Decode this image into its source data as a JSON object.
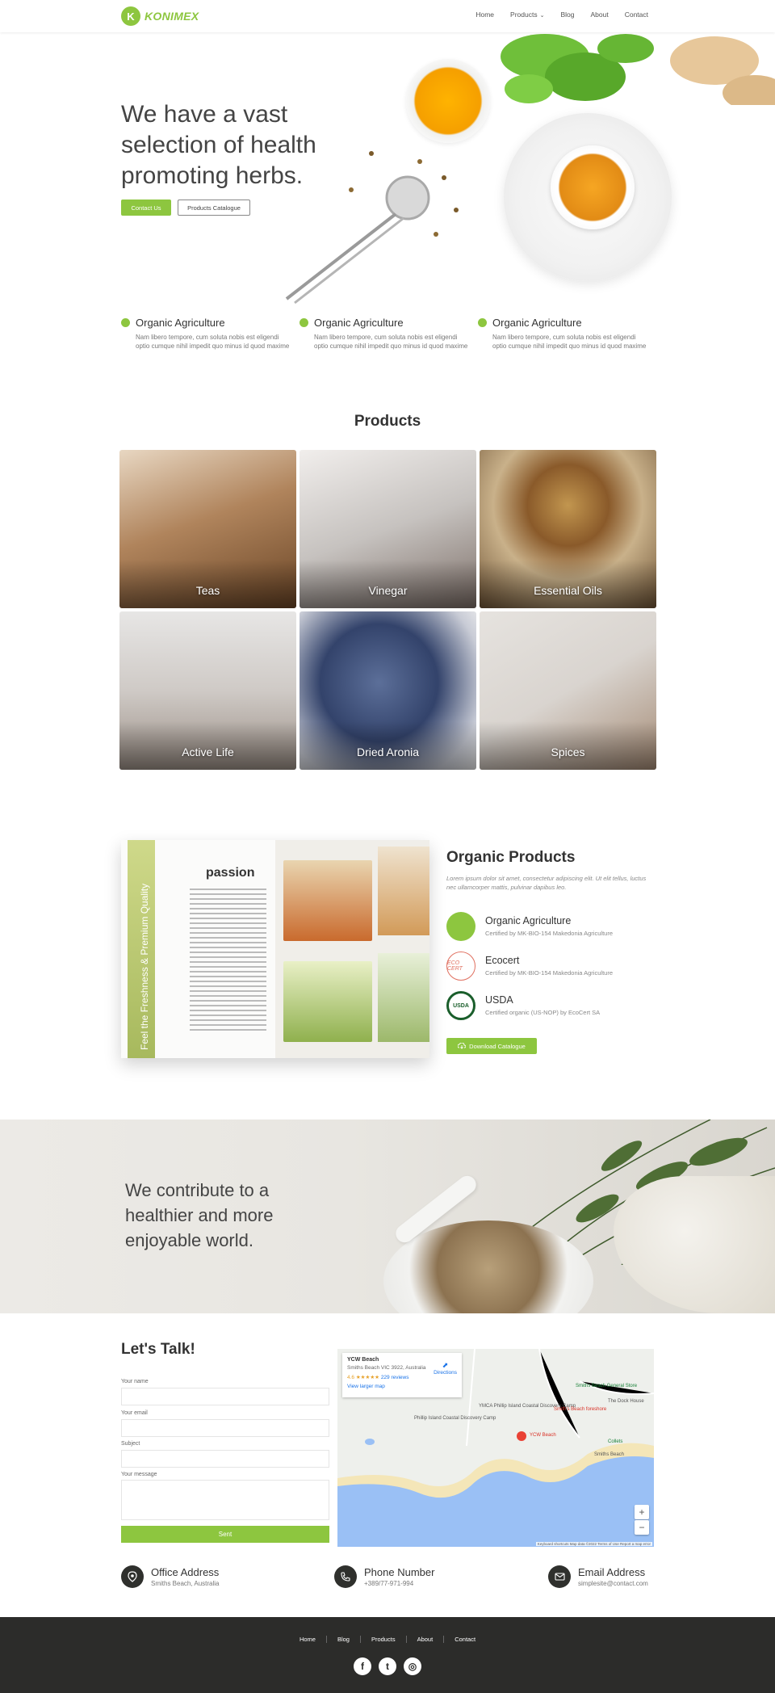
{
  "brand": {
    "logo_letter": "K",
    "name": "KONIMEX",
    "accent": "#8dc63f"
  },
  "nav": {
    "items": [
      "Home",
      "Products",
      "Blog",
      "About",
      "Contact"
    ],
    "products_caret": "⌄"
  },
  "hero": {
    "title": "We have a vast selection of health promoting herbs.",
    "primary_button": "Contact Us",
    "secondary_button": "Products Catalogue"
  },
  "features": [
    {
      "title": "Organic Agriculture",
      "desc": "Nam libero tempore, cum soluta nobis est eligendi optio cumque nihil impedit quo minus id quod maxime"
    },
    {
      "title": "Organic Agriculture",
      "desc": "Nam libero tempore, cum soluta nobis est eligendi optio cumque nihil impedit quo minus id quod maxime"
    },
    {
      "title": "Organic Agriculture",
      "desc": "Nam libero tempore, cum soluta nobis est eligendi optio cumque nihil impedit quo minus id quod maxime"
    }
  ],
  "products": {
    "title": "Products",
    "items": [
      "Teas",
      "Vinegar",
      "Essential Oils",
      "Active Life",
      "Dried Aronia",
      "Spices"
    ]
  },
  "catalog_image": {
    "strip_text": "Feel the Freshness & Premium Quality",
    "brand": "passion"
  },
  "organic": {
    "title": "Organic Products",
    "subtitle": "Lorem ipsum dolor sit amet, consectetur adipiscing elit. Ut elit tellus, luctus nec ullamcorper mattis, pulvinar dapibus leo.",
    "certs": [
      {
        "name": "Organic Agriculture",
        "desc": "Certified by MK-BIO-154 Makedonia Agriculture",
        "icon": "eu-organic-icon"
      },
      {
        "name": "Ecocert",
        "desc": "Certified by MK-BIO-154 Makedonia Agriculture",
        "icon": "ecocert-icon",
        "icon_text": "ECO CERT"
      },
      {
        "name": "USDA",
        "desc": "Certified organic (US-NOP) by EcoCert SA",
        "icon": "usda-icon",
        "icon_text": "USDA"
      }
    ],
    "download_button": "Download Catalogue"
  },
  "banner": {
    "text": "We contribute to a healthier and more enjoyable world."
  },
  "contact": {
    "title": "Let's Talk!",
    "fields": {
      "name_label": "Your name",
      "email_label": "Your email",
      "subject_label": "Subject",
      "message_label": "Your message"
    },
    "submit": "Sent"
  },
  "map": {
    "place_name": "YCW Beach",
    "address": "Smiths Beach VIC 3922, Australia",
    "rating": "4.6",
    "stars": "★★★★★",
    "reviews": "229 reviews",
    "larger_map": "View larger map",
    "directions": "Directions",
    "labels": [
      "Smiths Beach General Store",
      "YMCA Phillip Island Coastal Discovery Camp",
      "Smith's Beach foreshore",
      "Phillip Island Coastal Discovery Camp",
      "YCW Beach",
      "Smiths Beach",
      "The Dock House",
      "Collets"
    ],
    "footer": "Keyboard shortcuts   Map data ©2022   Terms of Use   Report a map error",
    "zoom_in": "+",
    "zoom_out": "−"
  },
  "info": [
    {
      "title": "Office Address",
      "value": "Smiths Beach, Australia",
      "icon": "location-pin-icon"
    },
    {
      "title": "Phone Number",
      "value": "+389/77-971-994",
      "icon": "phone-icon"
    },
    {
      "title": "Email Address",
      "value": "simplesite@contact.com",
      "icon": "envelope-icon"
    }
  ],
  "footer": {
    "links": [
      "Home",
      "Blog",
      "Products",
      "About",
      "Contact"
    ],
    "socials": [
      {
        "name": "facebook-icon",
        "glyph": "f"
      },
      {
        "name": "twitter-icon",
        "glyph": "t"
      },
      {
        "name": "instagram-icon",
        "glyph": "◎"
      }
    ]
  }
}
